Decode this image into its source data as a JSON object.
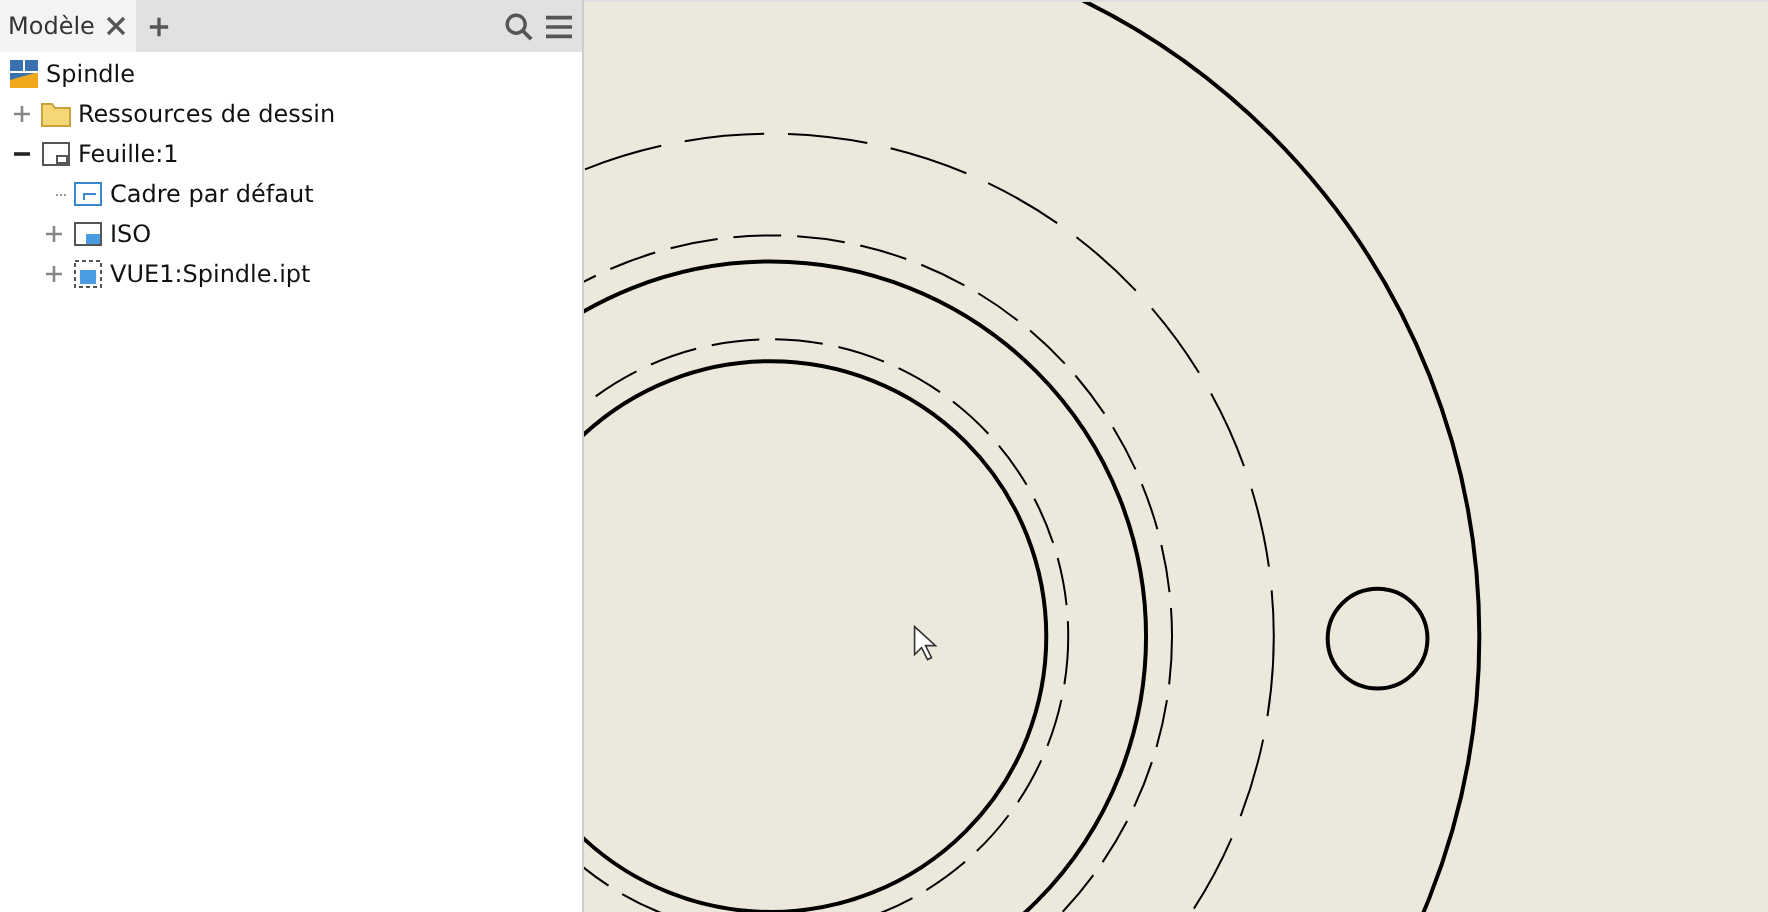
{
  "panel": {
    "tabs": [
      {
        "label": "Modèle",
        "selected": true
      }
    ],
    "tree": [
      {
        "label": "Spindle",
        "kind": "drawing-doc",
        "children": [
          {
            "label": "Ressources de dessin",
            "kind": "folder",
            "expanded": false
          },
          {
            "label": "Feuille:1",
            "kind": "sheet",
            "expanded": true,
            "children": [
              {
                "label": "Cadre par défaut",
                "kind": "border"
              },
              {
                "label": "ISO",
                "kind": "title-block",
                "expanded": false
              },
              {
                "label": "VUE1:Spindle.ipt",
                "kind": "view",
                "expanded": false
              }
            ]
          }
        ]
      }
    ]
  }
}
